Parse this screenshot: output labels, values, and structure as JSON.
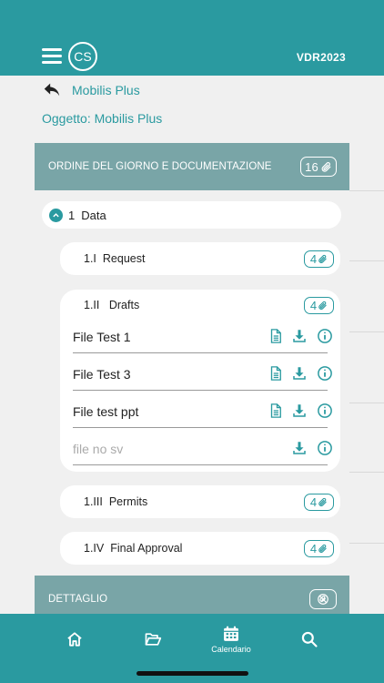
{
  "header": {
    "avatar_initials": "CS",
    "code": "VDR2023",
    "color": "#2a9aa0"
  },
  "back": {
    "label": "Mobilis Plus"
  },
  "subject": {
    "text": "Oggetto: Mobilis Plus"
  },
  "agenda": {
    "title": "ORDINE DEL GIORNO E DOCUMENTAZIONE",
    "count": "16"
  },
  "data_item": {
    "number": "1",
    "label": "Data"
  },
  "subitems": [
    {
      "number": "1.I",
      "label": "Request",
      "count": "4"
    },
    {
      "number": "1.II",
      "label": "Drafts",
      "count": "4"
    },
    {
      "number": "1.III",
      "label": "Permits",
      "count": "4"
    },
    {
      "number": "1.IV",
      "label": "Final Approval",
      "count": "4"
    }
  ],
  "files": [
    {
      "name": "File Test 1"
    },
    {
      "name": "File Test 3"
    },
    {
      "name": "File test ppt"
    },
    {
      "name": "file no sv"
    }
  ],
  "detail": {
    "title": "DETTAGLIO"
  },
  "tabs": {
    "calendar": "Calendario"
  }
}
